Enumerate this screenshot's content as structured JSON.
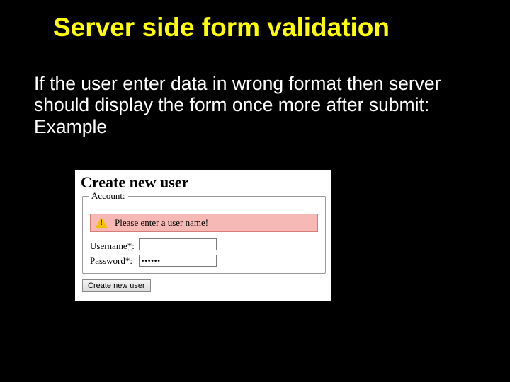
{
  "slide": {
    "title": "Server side form validation",
    "body": "If the user enter data in wrong format then server should display the form once more after submit: Example"
  },
  "form": {
    "heading": "Create new user",
    "legend": "Account:",
    "error_message": "Please enter a user name!",
    "fields": {
      "username": {
        "label": "Username",
        "required_mark": "*",
        "separator": ":",
        "value": ""
      },
      "password": {
        "label": "Password*:",
        "value_masked": "••••••"
      }
    },
    "submit_label": "Create new user"
  }
}
